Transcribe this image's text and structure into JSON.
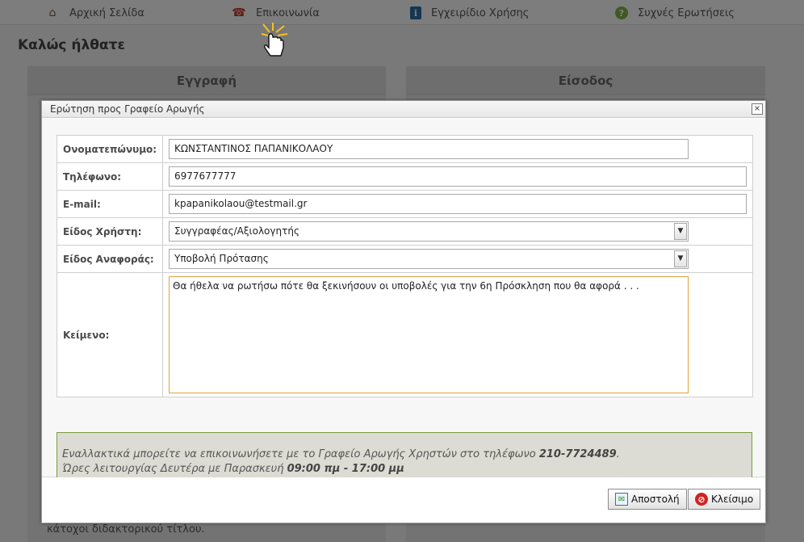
{
  "nav": {
    "items": [
      {
        "label": "Αρχική Σελίδα",
        "icon": "home-icon"
      },
      {
        "label": "Επικοινωνία",
        "icon": "phone-icon"
      },
      {
        "label": "Εγχειρίδιο Χρήσης",
        "icon": "info-icon"
      },
      {
        "label": "Συχνές Ερωτήσεις",
        "icon": "question-icon"
      }
    ]
  },
  "page": {
    "welcome": "Καλώς ήλθατε",
    "panel_left_title": "Εγγραφή",
    "panel_right_title": "Είσοδος",
    "panel_left_footer": "κάτοχοι διδακτορικού τίτλου."
  },
  "dialog": {
    "title": "Ερώτηση προς Γραφείο Αρωγής",
    "close_symbol": "×",
    "fields": {
      "name_label": "Ονοματεπώνυμο:",
      "name_value": "ΚΩΝΣΤΑΝΤΙΝΟΣ ΠΑΠΑΝΙΚΟΛΑΟΥ",
      "phone_label": "Τηλέφωνο:",
      "phone_value": "6977677777",
      "email_label": "E-mail:",
      "email_value": "kpapanikolaou@testmail.gr",
      "user_type_label": "Είδος Χρήστη:",
      "user_type_value": "Συγγραφέας/Αξιολογητής",
      "report_type_label": "Είδος Αναφοράς:",
      "report_type_value": "Υποβολή Πρότασης",
      "text_label": "Κείμενο:",
      "text_value": "Θα ήθελα να ρωτήσω πότε θα ξεκινήσουν οι υποβολές για την 6η Πρόσκληση που θα αφορά . . ."
    },
    "note": {
      "line1_text": "Εναλλακτικά μπορείτε να επικοινωνήσετε με το Γραφείο Αρωγής Χρηστών στο τηλέφωνο ",
      "line1_phone": "210-7724489",
      "line1_end": ".",
      "line2_text": "Ώρες λειτουργίας Δευτέρα με Παρασκευή ",
      "line2_hours": "09:00 πμ - 17:00 μμ"
    },
    "buttons": {
      "send": "Αποστολή",
      "close": "Κλείσιμο"
    }
  },
  "colors": {
    "note_border": "#7c9a3c",
    "textarea_focus_border": "#e0a33d",
    "close_icon_red": "#d32222"
  }
}
